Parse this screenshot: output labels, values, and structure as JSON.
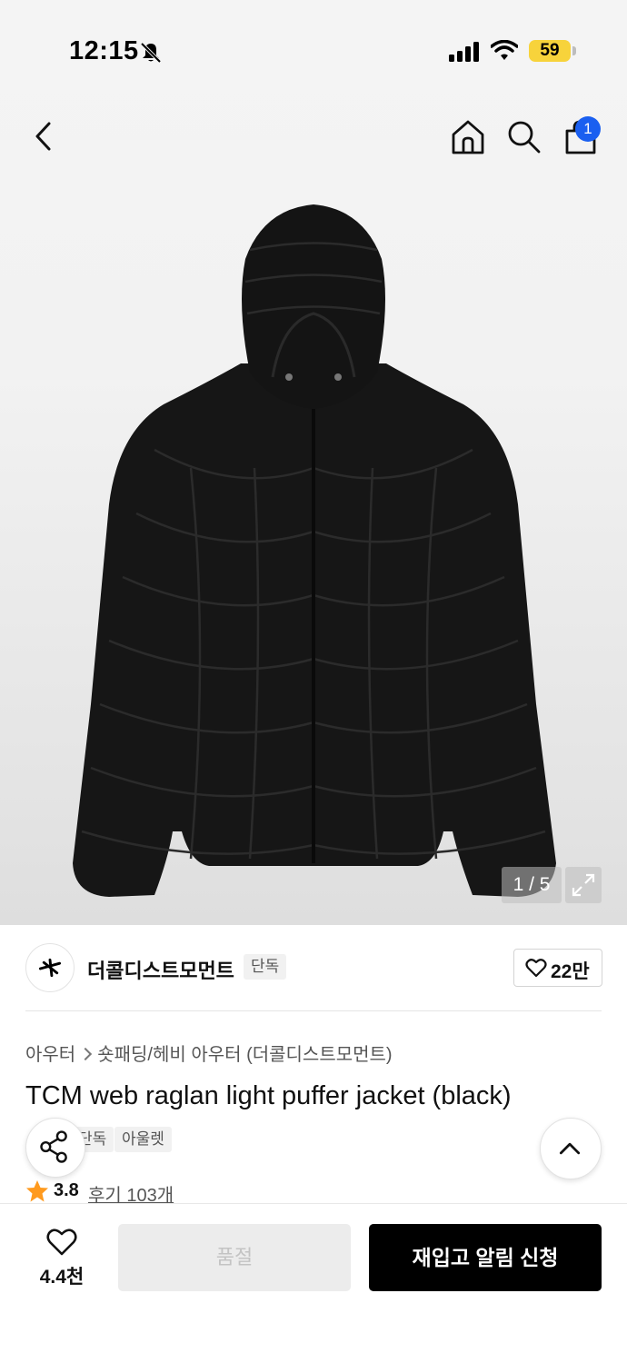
{
  "status_bar": {
    "time": "12:15",
    "battery": "59",
    "icons": [
      "bell-slash-icon",
      "signal-icon",
      "wifi-icon",
      "battery-icon"
    ]
  },
  "nav": {
    "icons": [
      "back-arrow-icon",
      "home-icon",
      "search-icon",
      "shopping-bag-icon"
    ],
    "cart_badge": "1"
  },
  "gallery": {
    "counter": "1 / 5",
    "expand_icon": "expand-icon"
  },
  "brand": {
    "name": "더콜디스트모먼트",
    "tag": "단독",
    "likes": "22만",
    "logo_icon": "brand-logo-icon"
  },
  "breadcrumb": {
    "category": "아우터",
    "subcategory": "숏패딩/헤비 아우터 (더콜디스트모먼트)"
  },
  "product": {
    "title": "TCM web raglan light puffer jacket (black)",
    "tags": [
      "단독",
      "아울렛"
    ],
    "rating": "3.8",
    "reviews": "후기 103개"
  },
  "floating": {
    "share_icon": "share-icon",
    "top_icon": "chevron-up-icon"
  },
  "bottom_bar": {
    "wish_count": "4.4천",
    "soldout_label": "품절",
    "restock_label": "재입고 알림 신청"
  },
  "colors": {
    "accent_blue": "#1a5ff0",
    "battery_yellow": "#f7d33b",
    "star_orange": "#ff9a1e",
    "primary_button": "#000000"
  }
}
